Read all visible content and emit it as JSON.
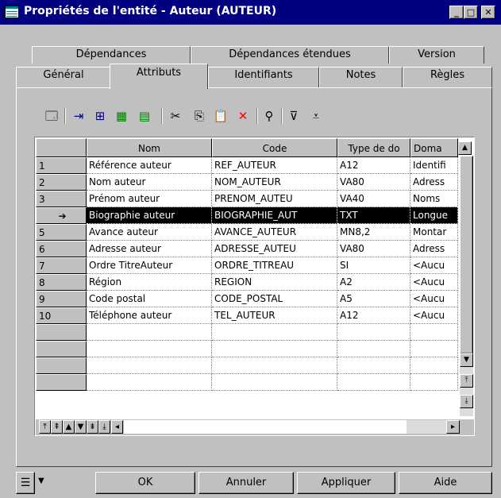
{
  "window": {
    "title": "Propriétés de l'entité - Auteur (AUTEUR)",
    "buttons": {
      "minimize": "_",
      "maximize": "□",
      "close": "✕"
    }
  },
  "tabs": {
    "back_row": [
      "Dépendances",
      "Dépendances étendues",
      "Version"
    ],
    "front_row": [
      "Général",
      "Attributs",
      "Identifiants",
      "Notes",
      "Règles"
    ],
    "active": "Attributs"
  },
  "toolbar": {
    "icons": [
      "properties-icon",
      "insert-row-icon",
      "add-row-icon",
      "add-attributes-icon",
      "reuse-attributes-icon",
      "cut-icon",
      "copy-icon",
      "paste-icon",
      "delete-icon",
      "find-icon",
      "filter-icon",
      "customize-columns-icon"
    ]
  },
  "grid": {
    "columns": [
      "Nom",
      "Code",
      "Type de do",
      "Doma"
    ],
    "rows": [
      {
        "num": "1",
        "nom": "Référence auteur",
        "code": "REF_AUTEUR",
        "type": "A12",
        "domaine": "Identifi"
      },
      {
        "num": "2",
        "nom": "Nom auteur",
        "code": "NOM_AUTEUR",
        "type": "VA80",
        "domaine": "Adress"
      },
      {
        "num": "3",
        "nom": "Prénom auteur",
        "code": "PRENOM_AUTEU",
        "type": "VA40",
        "domaine": "Noms"
      },
      {
        "num": "➔",
        "nom": "Biographie auteur",
        "code": "BIOGRAPHIE_AUT",
        "type": "TXT",
        "domaine": "Longue",
        "selected": true
      },
      {
        "num": "5",
        "nom": "Avance auteur",
        "code": "AVANCE_AUTEUR",
        "type": "MN8,2",
        "domaine": "Montar"
      },
      {
        "num": "6",
        "nom": "Adresse auteur",
        "code": "ADRESSE_AUTEU",
        "type": "VA80",
        "domaine": "Adress"
      },
      {
        "num": "7",
        "nom": "Ordre TitreAuteur",
        "code": "ORDRE_TITREAU",
        "type": "SI",
        "domaine": "<Aucu"
      },
      {
        "num": "8",
        "nom": "Région",
        "code": "REGION",
        "type": "A2",
        "domaine": "<Aucu"
      },
      {
        "num": "9",
        "nom": "Code postal",
        "code": "CODE_POSTAL",
        "type": "A5",
        "domaine": "<Aucu"
      },
      {
        "num": "10",
        "nom": "Téléphone auteur",
        "code": "TEL_AUTEUR",
        "type": "A12",
        "domaine": "<Aucu"
      }
    ],
    "empty_rows": 4,
    "nav_buttons": [
      "⤒",
      "⇞",
      "▲",
      "▼",
      "⇟",
      "⤓"
    ]
  },
  "footer": {
    "menu_icon": "list-menu-icon",
    "ok": "OK",
    "cancel": "Annuler",
    "apply": "Appliquer",
    "help": "Aide"
  }
}
